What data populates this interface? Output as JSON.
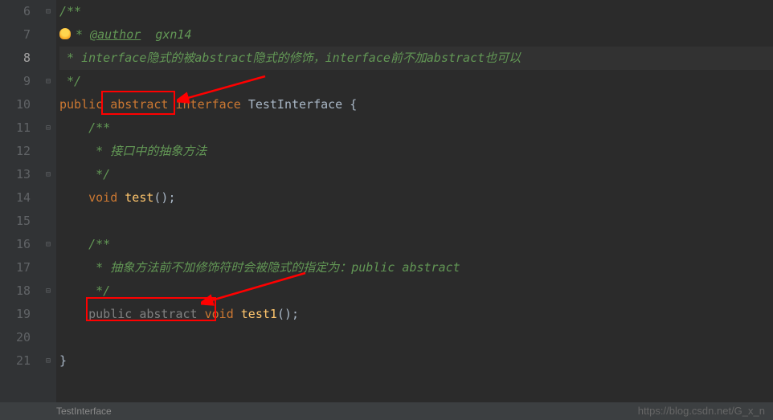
{
  "lines": {
    "start": 6,
    "end": 21,
    "current": 8
  },
  "code": {
    "l6": "/**",
    "l7_tag": "@author",
    "l7_val": "  gxn14",
    "l8": " * interface隐式的被abstract隐式的修饰，interface前不加abstract也可以",
    "l9": " */",
    "l10_kw1": "public",
    "l10_kw2": "abstract",
    "l10_kw3": "interface",
    "l10_name": "TestInterface",
    "l10_brace": " {",
    "l11": "/**",
    "l12": " * 接口中的抽象方法",
    "l13": " */",
    "l14_kw": "void",
    "l14_method": "test",
    "l14_end": "();",
    "l16": "/**",
    "l17": " * 抽象方法前不加修饰符时会被隐式的指定为：public abstract",
    "l18": " */",
    "l19_kw1": "public",
    "l19_kw2": "abstract",
    "l19_kw3": "void",
    "l19_method": "test1",
    "l19_end": "();",
    "l21": "}"
  },
  "breadcrumb": "TestInterface",
  "watermark": "https://blog.csdn.net/G_x_n",
  "annotations": {
    "highlight1": "abstract keyword on interface",
    "highlight2": "public abstract on method",
    "arrow1": "points to abstract on line 10",
    "arrow2": "points to public abstract on line 19"
  }
}
